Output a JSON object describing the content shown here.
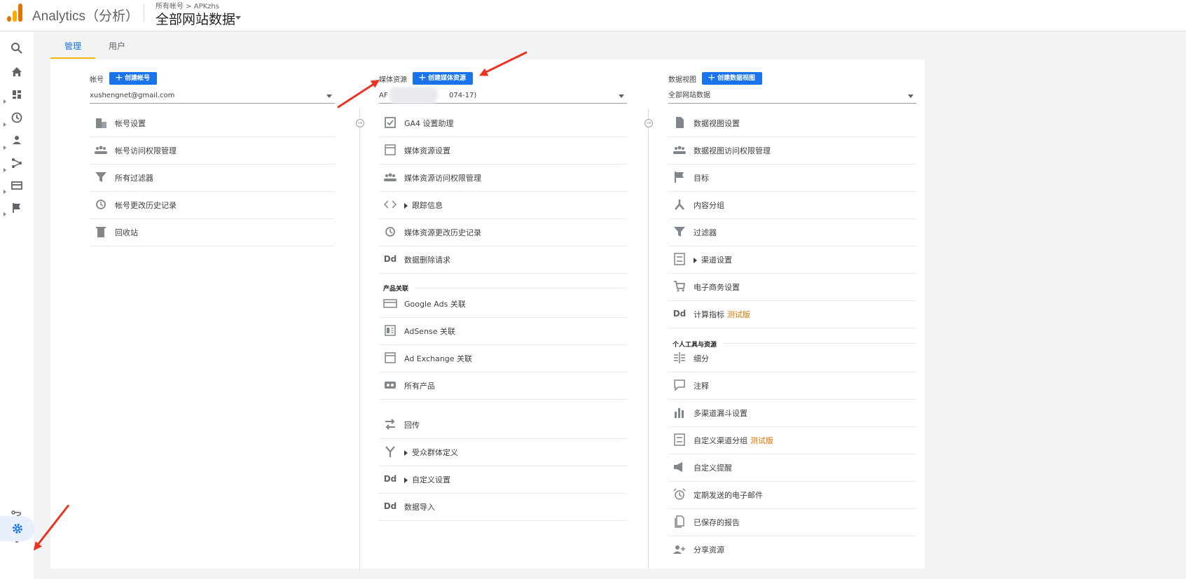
{
  "header": {
    "app_name": "Analytics（分析）",
    "breadcrumb": "所有帐号 > APKzhs",
    "view_title": "全部网站数据"
  },
  "tabs": [
    {
      "label": "管理",
      "active": true
    },
    {
      "label": "用户",
      "active": false
    }
  ],
  "account": {
    "heading": "帐号",
    "create_label": "创建帐号",
    "selected": "xushengnet@gmail.com",
    "items": [
      {
        "icon": "building-icon",
        "label": "帐号设置"
      },
      {
        "icon": "people-icon",
        "label": "帐号访问权限管理"
      },
      {
        "icon": "filter-icon",
        "label": "所有过滤器"
      },
      {
        "icon": "history-icon",
        "label": "帐号更改历史记录"
      },
      {
        "icon": "trash-icon",
        "label": "回收站"
      }
    ]
  },
  "property": {
    "heading": "媒体资源",
    "create_label": "创建媒体资源",
    "selected_prefix": "AF",
    "selected_suffix": "074-17)",
    "items": [
      {
        "icon": "checkbox-icon",
        "label": "GA4 设置助理"
      },
      {
        "icon": "window-icon",
        "label": "媒体资源设置"
      },
      {
        "icon": "people-icon",
        "label": "媒体资源访问权限管理"
      },
      {
        "icon": "code-icon",
        "label": "跟踪信息",
        "expandable": true
      },
      {
        "icon": "history-icon",
        "label": "媒体资源更改历史记录"
      },
      {
        "icon": "dd-icon",
        "label": "数据删除请求"
      }
    ],
    "section_label": "产品关联",
    "product_items": [
      {
        "icon": "ads-icon",
        "label": "Google Ads 关联"
      },
      {
        "icon": "adsense-icon",
        "label": "AdSense 关联"
      },
      {
        "icon": "window-icon",
        "label": "Ad Exchange 关联"
      },
      {
        "icon": "link-icon",
        "label": "所有产品"
      }
    ],
    "extra_items": [
      {
        "icon": "postback-icon",
        "label": "回传"
      },
      {
        "icon": "fork-icon",
        "label": "受众群体定义",
        "expandable": true
      },
      {
        "icon": "dd-icon",
        "label": "自定义设置",
        "expandable": true
      },
      {
        "icon": "dd-icon",
        "label": "数据导入"
      }
    ]
  },
  "view": {
    "heading": "数据视图",
    "create_label": "创建数据视图",
    "selected": "全部网站数据",
    "items": [
      {
        "icon": "document-icon",
        "label": "数据视图设置"
      },
      {
        "icon": "people-icon",
        "label": "数据视图访问权限管理"
      },
      {
        "icon": "flag-icon",
        "label": "目标"
      },
      {
        "icon": "grouping-icon",
        "label": "内容分组"
      },
      {
        "icon": "filter-icon",
        "label": "过滤器"
      },
      {
        "icon": "channel-icon",
        "label": "渠道设置",
        "expandable": true
      },
      {
        "icon": "cart-icon",
        "label": "电子商务设置"
      },
      {
        "icon": "dd-icon",
        "label": "计算指标",
        "beta": "测试版"
      }
    ],
    "section_label": "个人工具与资源",
    "personal_items": [
      {
        "icon": "segment-icon",
        "label": "细分"
      },
      {
        "icon": "comment-icon",
        "label": "注释"
      },
      {
        "icon": "bar-chart-icon",
        "label": "多渠道漏斗设置"
      },
      {
        "icon": "channel-icon",
        "label": "自定义渠道分组",
        "beta": "测试版"
      },
      {
        "icon": "megaphone-icon",
        "label": "自定义提醒"
      },
      {
        "icon": "alarm-icon",
        "label": "定期发送的电子邮件"
      },
      {
        "icon": "saved-report-icon",
        "label": "已保存的报告"
      },
      {
        "icon": "share-icon",
        "label": "分享资源"
      }
    ]
  }
}
